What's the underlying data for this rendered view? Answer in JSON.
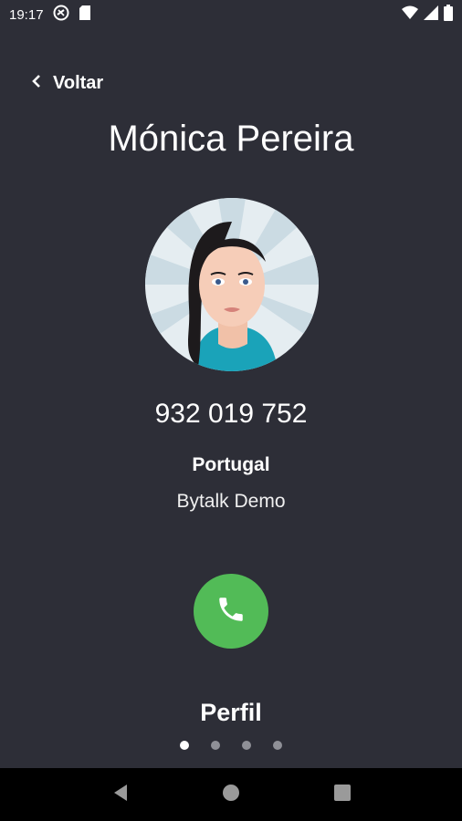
{
  "status_bar": {
    "time": "19:17",
    "icons_left": [
      "do-not-disturb-icon",
      "sim-card-icon"
    ],
    "icons_right": [
      "wifi-icon",
      "signal-icon",
      "battery-icon"
    ]
  },
  "header": {
    "back_label": "Voltar"
  },
  "contact": {
    "name": "Mónica Pereira",
    "phone": "932 019 752",
    "country": "Portugal",
    "company": "Bytalk Demo"
  },
  "actions": {
    "call_icon": "phone-icon"
  },
  "pager": {
    "label": "Perfil",
    "page_count": 4,
    "active_index": 0
  },
  "colors": {
    "background": "#2d2e37",
    "call_button": "#52bb57",
    "dot_active": "#ffffff",
    "dot_inactive": "#8f9097"
  }
}
